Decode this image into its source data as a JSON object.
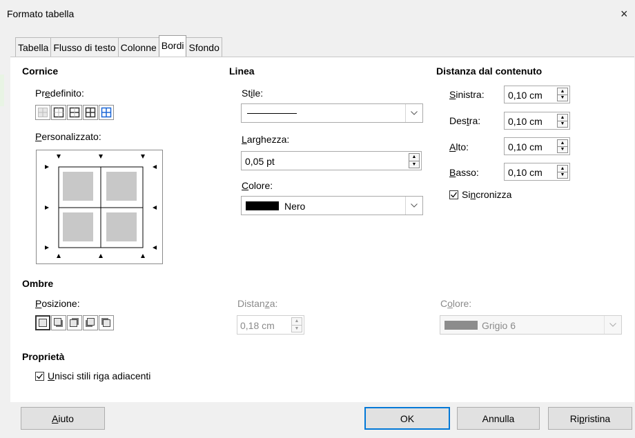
{
  "window": {
    "title": "Formato tabella",
    "close_label": "×"
  },
  "tabs": [
    {
      "label": "Tabella"
    },
    {
      "label": "Flusso di testo"
    },
    {
      "label": "Colonne"
    },
    {
      "label": "Bordi",
      "active": true
    },
    {
      "label": "Sfondo"
    }
  ],
  "cornice": {
    "header": "Cornice",
    "predefinito_pre": "Pr",
    "predefinito_acc": "e",
    "predefinito_post": "definito:",
    "preset_icons": [
      "border-none-icon",
      "border-outer-icon",
      "border-outer-horizontal-icon",
      "border-all-icon",
      "border-inner-only-icon"
    ],
    "personalizzato_acc": "P",
    "personalizzato_post": "ersonalizzato:"
  },
  "linea": {
    "header": "Linea",
    "stile_pre": "St",
    "stile_acc": "i",
    "stile_post": "le:",
    "larghezza_acc": "L",
    "larghezza_post": "arghezza:",
    "larghezza_value": "0,05 pt",
    "colore_acc": "C",
    "colore_post": "olore:",
    "colore_value": "Nero",
    "colore_swatch": "#000000"
  },
  "distanza": {
    "header": "Distanza dal contenuto",
    "rows": [
      {
        "acc": "S",
        "post": "inistra:",
        "pre": "",
        "value": "0,10 cm"
      },
      {
        "pre": "Des",
        "acc": "t",
        "post": "ra:",
        "value": "0,10 cm"
      },
      {
        "pre": "",
        "acc": "A",
        "post": "lto:",
        "value": "0,10 cm"
      },
      {
        "pre": "",
        "acc": "B",
        "post": "asso:",
        "value": "0,10 cm"
      }
    ],
    "sincronizza_pre": "Si",
    "sincronizza_acc": "n",
    "sincronizza_post": "cronizza",
    "sincronizza_checked": true
  },
  "ombre": {
    "header": "Ombre",
    "posizione_acc": "P",
    "posizione_post": "osizione:",
    "shadow_icons": [
      "shadow-none-icon",
      "shadow-bottom-right-icon",
      "shadow-top-right-icon",
      "shadow-bottom-left-icon",
      "shadow-top-left-icon"
    ],
    "distanza_pre": "Distan",
    "distanza_acc": "z",
    "distanza_post": "a:",
    "distanza_value": "0,18 cm",
    "colore_pre": "C",
    "colore_acc": "o",
    "colore_post": "lore:",
    "colore_value": "Grigio 6",
    "colore_swatch": "#8c8c8c"
  },
  "proprieta": {
    "header": "Proprietà",
    "unisci_acc": "U",
    "unisci_post": "nisci stili riga adiacenti",
    "unisci_checked": true
  },
  "buttons": {
    "aiuto_acc": "A",
    "aiuto_post": "iuto",
    "ok": "OK",
    "annulla": "Annulla",
    "ripristina_pre": "Ri",
    "ripristina_acc": "p",
    "ripristina_post": "ristina"
  },
  "colors": {
    "accent": "#0078d7",
    "preset_blue": "#1a66d6"
  }
}
